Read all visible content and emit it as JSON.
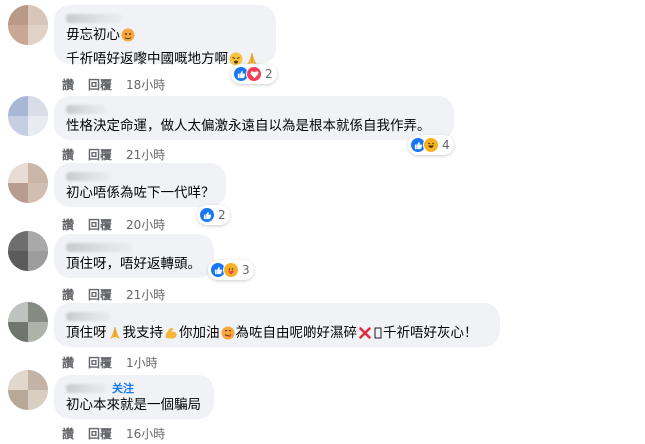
{
  "colors": {
    "bubble": "#f0f2f5",
    "meta": "#65676b",
    "like": "#1877f2",
    "love": "#f33e58",
    "haha": "#f7b125"
  },
  "comments": [
    {
      "name_obscured": true,
      "lines": [
        "毋忘初心",
        "千祈唔好返嚟中國嘅地方啊"
      ],
      "actions": {
        "like": "讚",
        "reply": "回覆",
        "time": "18小時"
      },
      "reactions": {
        "icons": [
          "like-icon",
          "love-icon"
        ],
        "count": "2"
      }
    },
    {
      "name_obscured": true,
      "lines": [
        "性格決定命運，做人太偏激永遠自以為是根本就係自我作弄。"
      ],
      "actions": {
        "like": "讚",
        "reply": "回覆",
        "time": "21小時"
      },
      "reactions": {
        "icons": [
          "like-icon",
          "haha-icon"
        ],
        "count": "4"
      }
    },
    {
      "name_obscured": true,
      "lines": [
        "初心唔係為咗下一代咩？"
      ],
      "actions": {
        "like": "讚",
        "reply": "回覆",
        "time": "20小時"
      },
      "reactions": {
        "icons": [
          "like-icon"
        ],
        "count": "2"
      }
    },
    {
      "name_obscured": true,
      "lines": [
        "頂住呀，唔好返轉頭。"
      ],
      "actions": {
        "like": "讚",
        "reply": "回覆",
        "time": "21小時"
      },
      "reactions": {
        "icons": [
          "like-icon",
          "care-icon"
        ],
        "count": "3"
      }
    },
    {
      "name_obscured": true,
      "segments": [
        "頂住呀",
        "我支持",
        "你加油",
        "為咗自由呢啲好濕碎",
        "千祈唔好灰心！"
      ],
      "actions": {
        "like": "讚",
        "reply": "回覆",
        "time": "1小時"
      }
    },
    {
      "name_obscured": true,
      "follow_label": "关注",
      "lines": [
        "初心本來就是一個騙局"
      ],
      "actions": {
        "like": "讚",
        "reply": "回覆",
        "time": "16小時"
      }
    }
  ]
}
